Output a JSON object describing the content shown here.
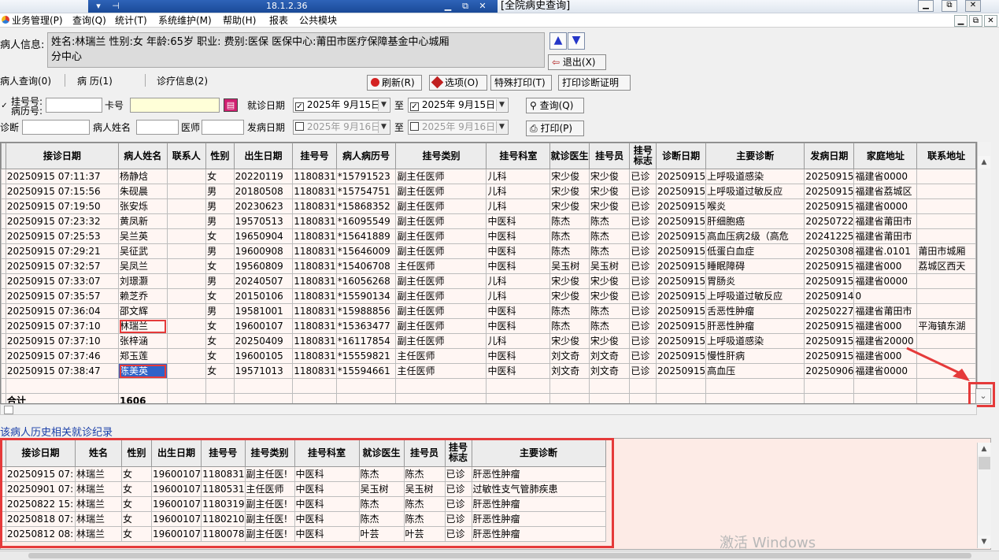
{
  "remote": {
    "address": "18.1.2.36",
    "pin": "⊣",
    "minimize": "▁",
    "restore": "⧉",
    "close": "✕"
  },
  "window": {
    "title": "[全院病史查询]",
    "minimize": "▁",
    "restore": "⧉",
    "close": "✕"
  },
  "menu": [
    "业务管理(P)",
    "查询(Q)",
    "统计(T)",
    "系统维护(M)",
    "帮助(H)",
    "报表",
    "公共模块"
  ],
  "patient": {
    "label": "病人信息:",
    "line1": "姓名:林瑞兰  性别:女  年龄:65岁   职业:  费别:医保  医保中心:莆田市医疗保障基金中心城厢",
    "line2": "分中心"
  },
  "nav": {
    "up": "▲",
    "down": "▼",
    "exit": "退出(X)"
  },
  "tabs": [
    "病人查询(0)",
    "病  历(1)",
    "诊疗信息(2)"
  ],
  "toolbar": {
    "refresh": "刷新(R)",
    "options": "选项(O)",
    "special_print": "特殊打印(T)",
    "print_cert": "打印诊断证明"
  },
  "search": {
    "reg_no_label": "挂号号:",
    "record_no_label": "病历号:",
    "card_label": "卡号",
    "visit_date_label": "就诊日期",
    "visit_from": "2025年  9月15日",
    "visit_to": "2025年  9月15日",
    "to": "至",
    "query": "查询(Q)",
    "diag_label": "诊断",
    "name_label": "病人姓名",
    "doctor_label": "医师",
    "onset_label": "发病日期",
    "onset_from": "2025年  9月16日",
    "onset_to": "2025年  9月16日",
    "print": "打印(P)"
  },
  "grid1": {
    "headers": [
      "接诊日期",
      "病人姓名",
      "联系人",
      "性别",
      "出生日期",
      "挂号号",
      "病人病历号",
      "挂号类别",
      "挂号科室",
      "就诊医生",
      "挂号员",
      "挂号标志",
      "诊断日期",
      "主要诊断",
      "发病日期",
      "家庭地址",
      "联系地址"
    ],
    "rows": [
      [
        "20250915 07:11:37",
        "杨静焓",
        "",
        "女",
        "20220119",
        "1180831",
        "*15791523",
        "副主任医师",
        "儿科",
        "宋少俊",
        "宋少俊",
        "已诊",
        "20250915",
        "上呼吸道感染",
        "20250915",
        "福建省0000",
        ""
      ],
      [
        "20250915 07:15:56",
        "朱砚晨",
        "",
        "男",
        "20180508",
        "1180831",
        "*15754751",
        "副主任医师",
        "儿科",
        "宋少俊",
        "宋少俊",
        "已诊",
        "20250915",
        "上呼吸道过敏反应",
        "20250915",
        "福建省荔城区",
        ""
      ],
      [
        "20250915 07:19:50",
        "张安烁",
        "",
        "男",
        "20230623",
        "1180831",
        "*15868352",
        "副主任医师",
        "儿科",
        "宋少俊",
        "宋少俊",
        "已诊",
        "20250915",
        "喉炎",
        "20250915",
        "福建省0000",
        ""
      ],
      [
        "20250915 07:23:32",
        "黄凤新",
        "",
        "男",
        "19570513",
        "1180831",
        "*16095549",
        "副主任医师",
        "中医科",
        "陈杰",
        "陈杰",
        "已诊",
        "20250915",
        "肝细胞癌",
        "20250722",
        "福建省莆田市",
        ""
      ],
      [
        "20250915 07:25:53",
        "吴兰英",
        "",
        "女",
        "19650904",
        "1180831",
        "*15641889",
        "副主任医师",
        "中医科",
        "陈杰",
        "陈杰",
        "已诊",
        "20250915",
        "高血压病2级（高危",
        "20241225",
        "福建省莆田市",
        ""
      ],
      [
        "20250915 07:29:21",
        "吴征武",
        "",
        "男",
        "19600908",
        "1180831",
        "*15646009",
        "副主任医师",
        "中医科",
        "陈杰",
        "陈杰",
        "已诊",
        "20250915",
        "低蛋白血症",
        "20250308",
        "福建省.0101",
        "莆田市城厢"
      ],
      [
        "20250915 07:32:57",
        "吴凤兰",
        "",
        "女",
        "19560809",
        "1180831",
        "*15406708",
        "主任医师",
        "中医科",
        "吴玉树",
        "吴玉树",
        "已诊",
        "20250915",
        "睡眠障碍",
        "20250915",
        "福建省000",
        "荔城区西天"
      ],
      [
        "20250915 07:33:07",
        "刘璟灏",
        "",
        "男",
        "20240507",
        "1180831",
        "*16056268",
        "副主任医师",
        "儿科",
        "宋少俊",
        "宋少俊",
        "已诊",
        "20250915",
        "胃肠炎",
        "20250915",
        "福建省0000",
        ""
      ],
      [
        "20250915 07:35:57",
        "赖芝乔",
        "",
        "女",
        "20150106",
        "1180831",
        "*15590134",
        "副主任医师",
        "儿科",
        "宋少俊",
        "宋少俊",
        "已诊",
        "20250915",
        "上呼吸道过敏反应",
        "20250914",
        "0",
        ""
      ],
      [
        "20250915 07:36:04",
        "邵文辉",
        "",
        "男",
        "19581001",
        "1180831",
        "*15988856",
        "副主任医师",
        "中医科",
        "陈杰",
        "陈杰",
        "已诊",
        "20250915",
        "舌恶性肿瘤",
        "20250227",
        "福建省莆田市",
        ""
      ],
      [
        "20250915 07:37:10",
        "林瑞兰",
        "",
        "女",
        "19600107",
        "1180831",
        "*15363477",
        "副主任医师",
        "中医科",
        "陈杰",
        "陈杰",
        "已诊",
        "20250915",
        "肝恶性肿瘤",
        "20250915",
        "福建省000",
        "平海镇东湖"
      ],
      [
        "20250915 07:37:10",
        "张梓涵",
        "",
        "女",
        "20250409",
        "1180831",
        "*16117854",
        "副主任医师",
        "儿科",
        "宋少俊",
        "宋少俊",
        "已诊",
        "20250915",
        "上呼吸道感染",
        "20250915",
        "福建省20000",
        ""
      ],
      [
        "20250915 07:37:46",
        "郑玉莲",
        "",
        "女",
        "19600105",
        "1180831",
        "*15559821",
        "主任医师",
        "中医科",
        "刘文奇",
        "刘文奇",
        "已诊",
        "20250915",
        "慢性肝病",
        "20250915",
        "福建省000",
        ""
      ],
      [
        "20250915 07:38:47",
        "陈美英",
        "",
        "女",
        "19571013",
        "1180831",
        "*15594661",
        "主任医师",
        "中医科",
        "刘文奇",
        "刘文奇",
        "已诊",
        "20250915",
        "高血压",
        "20250906",
        "福建省0000",
        ""
      ]
    ],
    "total_label": "合计",
    "total_value": "1606"
  },
  "history": {
    "label": "该病人历史相关就诊纪录",
    "headers": [
      "接诊日期",
      "姓名",
      "性别",
      "出生日期",
      "挂号号",
      "挂号类别",
      "挂号科室",
      "就诊医生",
      "挂号员",
      "挂号标志",
      "主要诊断"
    ],
    "rows": [
      [
        "20250915 07:",
        "林瑞兰",
        "女",
        "19600107",
        "1180831",
        "副主任医!",
        "中医科",
        "陈杰",
        "陈杰",
        "已诊",
        "肝恶性肿瘤"
      ],
      [
        "20250901 07:",
        "林瑞兰",
        "女",
        "19600107",
        "1180531",
        "主任医师",
        "中医科",
        "吴玉树",
        "吴玉树",
        "已诊",
        "过敏性支气管肺疾患"
      ],
      [
        "20250822 15:",
        "林瑞兰",
        "女",
        "19600107",
        "1180319",
        "副主任医!",
        "中医科",
        "陈杰",
        "陈杰",
        "已诊",
        "肝恶性肿瘤"
      ],
      [
        "20250818 07:",
        "林瑞兰",
        "女",
        "19600107",
        "1180210",
        "副主任医!",
        "中医科",
        "陈杰",
        "陈杰",
        "已诊",
        "肝恶性肿瘤"
      ],
      [
        "20250812 08:",
        "林瑞兰",
        "女",
        "19600107",
        "1180078",
        "副主任医!",
        "中医科",
        "叶芸",
        "叶芸",
        "已诊",
        "肝恶性肿瘤"
      ]
    ]
  },
  "watermark": "激活 Windows",
  "colors": {
    "highlight": "#e53a3a",
    "selection": "#2f63c8",
    "row_bg": "#fff6f3"
  }
}
